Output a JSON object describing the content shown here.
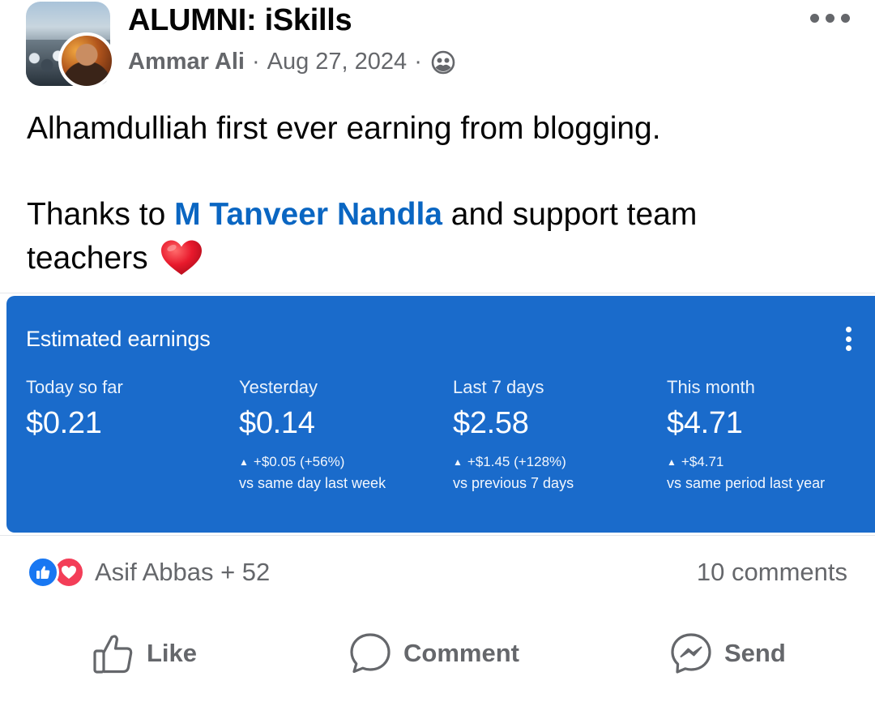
{
  "post": {
    "group_name": "ALUMNI: iSkills",
    "author": "Ammar Ali",
    "separator": "·",
    "date": "Aug 27, 2024",
    "privacy_icon": "members-icon",
    "more_icon": "more-horizontal-icon"
  },
  "body": {
    "line1": "Alhamdulliah first ever earning from blogging.",
    "thanks_prefix": "Thanks to ",
    "mention": "M Tanveer Nandla",
    "thanks_suffix": " and support team",
    "line3": "teachers",
    "emoji": "red-heart"
  },
  "earnings_card": {
    "title": "Estimated earnings",
    "menu_icon": "more-vertical-icon",
    "background": "#1a6bcb",
    "stats": [
      {
        "label": "Today so far",
        "value": "$0.21",
        "change": "",
        "compare": ""
      },
      {
        "label": "Yesterday",
        "value": "$0.14",
        "change": "+$0.05 (+56%)",
        "compare": "vs same day last week"
      },
      {
        "label": "Last 7 days",
        "value": "$2.58",
        "change": "+$1.45 (+128%)",
        "compare": "vs previous 7 days"
      },
      {
        "label": "This month",
        "value": "$4.71",
        "change": "+$4.71",
        "compare": "vs same period last year"
      }
    ],
    "change_arrow": "▲"
  },
  "engagement": {
    "reactions": [
      "like",
      "love"
    ],
    "reaction_names": "Asif Abbas + 52",
    "comments": "10 comments"
  },
  "actions": {
    "like": "Like",
    "comment": "Comment",
    "send": "Send"
  },
  "colors": {
    "mention": "#0a66c2",
    "secondary_text": "#65676b",
    "like_blue": "#1877f2",
    "love_red": "#f33e58"
  }
}
